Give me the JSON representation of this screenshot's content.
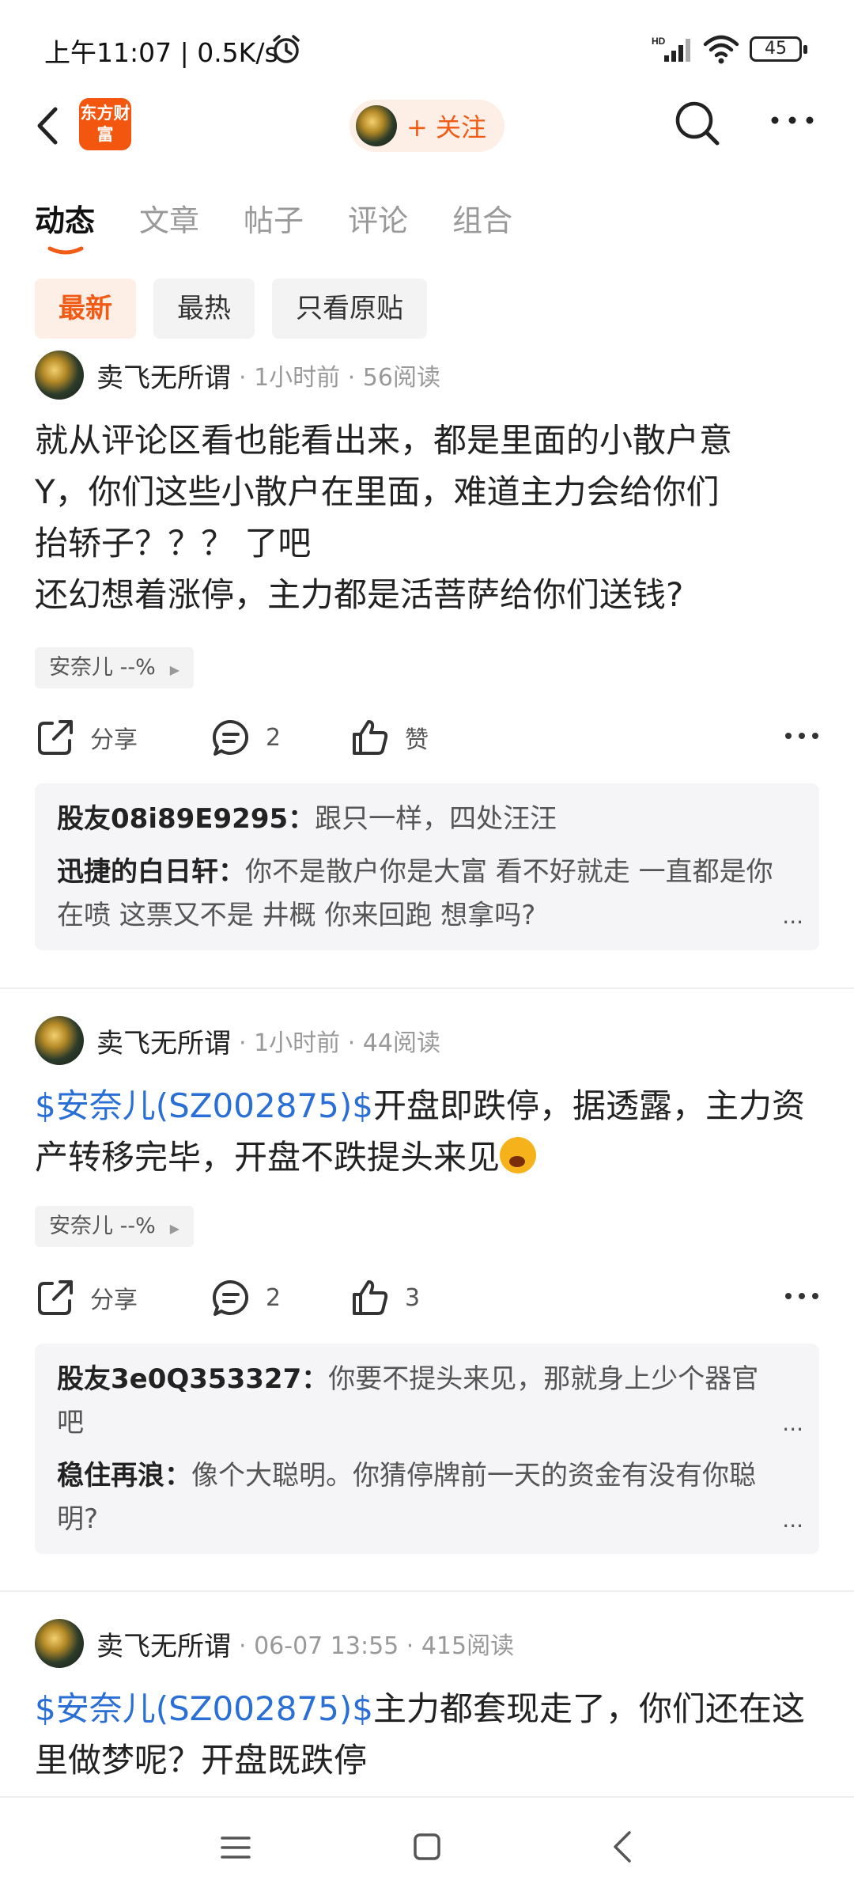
{
  "status_bar": {
    "time": "上午11:07 | 0.5K/s",
    "battery": "45"
  },
  "header": {
    "logo_text": "东方财富",
    "follow_label": "+ 关注"
  },
  "tabs": [
    {
      "label": "动态",
      "active": true
    },
    {
      "label": "文章",
      "active": false
    },
    {
      "label": "帖子",
      "active": false
    },
    {
      "label": "评论",
      "active": false
    },
    {
      "label": "组合",
      "active": false
    }
  ],
  "filters": [
    {
      "label": "最新",
      "active": true
    },
    {
      "label": "最热",
      "active": false
    },
    {
      "label": "只看原贴",
      "active": false
    }
  ],
  "posts": [
    {
      "author": "卖飞无所谓",
      "meta": "· 1小时前 · 56阅读",
      "stock_link": "",
      "body_lines": [
        "就从评论区看也能看出来，都是里面的小散户意",
        "Y，你们这些小散户在里面，难道主力会给你们",
        "抬轿子？？？ 了吧",
        "还幻想着涨停，主力都是活菩萨给你们送钱?"
      ],
      "stock_chip": "安奈儿 --%",
      "share_label": "分享",
      "comment_count": "2",
      "like_label": "赞",
      "comments": [
        {
          "name": "股友08i89E9295",
          "text": "跟只一样，四处汪汪"
        },
        {
          "name": "迅捷的白日轩",
          "text": "你不是散户你是大富 看不好就走 一直都是你在喷 这票又不是 井概 你来回跑 想拿吗?"
        }
      ]
    },
    {
      "author": "卖飞无所谓",
      "meta": "· 1小时前 · 44阅读",
      "stock_link": "$安奈儿(SZ002875)$",
      "body_lines": [
        "开盘即跌停，据透露，主力资产转移完毕，开盘不跌提头来见"
      ],
      "stock_chip": "安奈儿 --%",
      "share_label": "分享",
      "comment_count": "2",
      "like_label": "3",
      "comments": [
        {
          "name": "股友3e0Q353327",
          "text": "你要不提头来见，那就身上少个器官吧"
        },
        {
          "name": "稳住再浪",
          "text": "像个大聪明。你猜停牌前一天的资金有没有你聪明?"
        }
      ]
    },
    {
      "author": "卖飞无所谓",
      "meta": "· 06-07 13:55 · 415阅读",
      "stock_link": "$安奈儿(SZ002875)$",
      "body_lines": [
        "主力都套现走了，你们还在这里做梦呢？开盘既跌停"
      ]
    }
  ],
  "ellipsis": "...",
  "colors": {
    "accent": "#f05b16",
    "link": "#2a6fd6",
    "logo_bg": "#f3560f"
  }
}
